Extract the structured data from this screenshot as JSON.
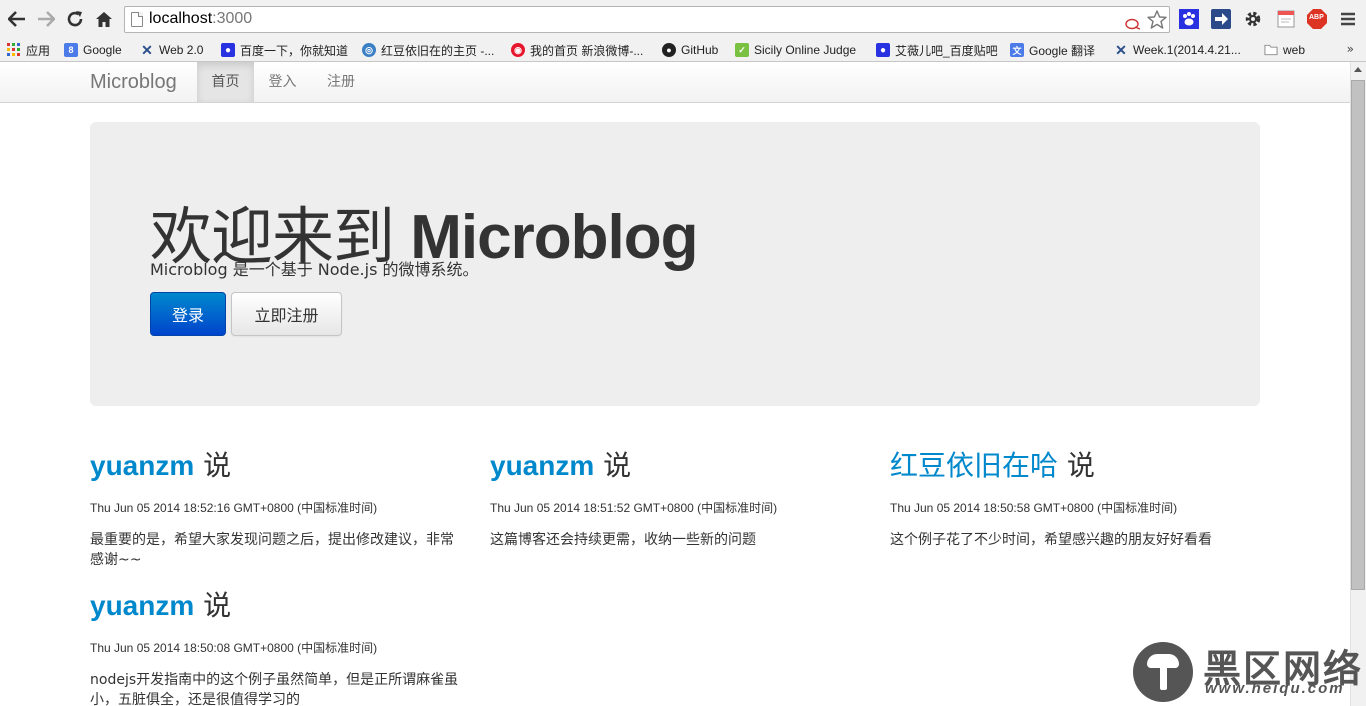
{
  "browser": {
    "url_host": "localhost",
    "url_port": ":3000",
    "icons": {
      "back": "back-arrow-icon",
      "forward": "forward-arrow-icon",
      "reload": "reload-icon",
      "home": "home-icon",
      "star": "bookmark-star-icon"
    },
    "bookmarks": [
      {
        "label": "应用",
        "icon": "apps-grid-icon"
      },
      {
        "label": "Google",
        "icon": "google-icon"
      },
      {
        "label": "Web 2.0",
        "icon": "web2-icon"
      },
      {
        "label": "百度一下，你就知道",
        "icon": "baidu-paw-icon"
      },
      {
        "label": "红豆依旧在的主页 -...",
        "icon": "site-icon"
      },
      {
        "label": "我的首页 新浪微博-...",
        "icon": "weibo-icon"
      },
      {
        "label": "GitHub",
        "icon": "github-icon"
      },
      {
        "label": "Sicily Online Judge",
        "icon": "check-icon"
      },
      {
        "label": "艾薇儿吧_百度贴吧",
        "icon": "baidu-paw-icon"
      },
      {
        "label": "Google 翻译",
        "icon": "translate-icon"
      },
      {
        "label": "Week.1(2014.4.21...",
        "icon": "web2-icon"
      },
      {
        "label": "web",
        "icon": "folder-icon"
      }
    ],
    "bookmarks_more": "»",
    "extension_abp": "ABP"
  },
  "navbar": {
    "brand": "Microblog",
    "items": [
      {
        "label": "首页",
        "active": true
      },
      {
        "label": "登入",
        "active": false
      },
      {
        "label": "注册",
        "active": false
      }
    ]
  },
  "hero": {
    "title_cjk": "欢迎来到",
    "title_latin": "Microblog",
    "subtitle": "Microblog 是一个基于 Node.js 的微博系统。",
    "login_label": "登录",
    "register_label": "立即注册"
  },
  "posts": [
    {
      "user": "yuanzm",
      "says": "说",
      "time": "Thu Jun 05 2014 18:52:16 GMT+0800 (中国标准时间)",
      "body": "最重要的是，希望大家发现问题之后，提出修改建议，非常感谢~~"
    },
    {
      "user": "yuanzm",
      "says": "说",
      "time": "Thu Jun 05 2014 18:51:52 GMT+0800 (中国标准时间)",
      "body": "这篇博客还会持续更需，收纳一些新的问题"
    },
    {
      "user": "红豆依旧在哈",
      "says": "说",
      "time": "Thu Jun 05 2014 18:50:58 GMT+0800 (中国标准时间)",
      "body": "这个例子花了不少时间，希望感兴趣的朋友好好看看"
    },
    {
      "user": "yuanzm",
      "says": "说",
      "time": "Thu Jun 05 2014 18:50:08 GMT+0800 (中国标准时间)",
      "body": "nodejs开发指南中的这个例子虽然简单，但是正所谓麻雀虽小，五脏俱全，还是很值得学习的"
    }
  ],
  "watermark": {
    "text": "黑区网络",
    "url": "www.heiqu.com"
  }
}
